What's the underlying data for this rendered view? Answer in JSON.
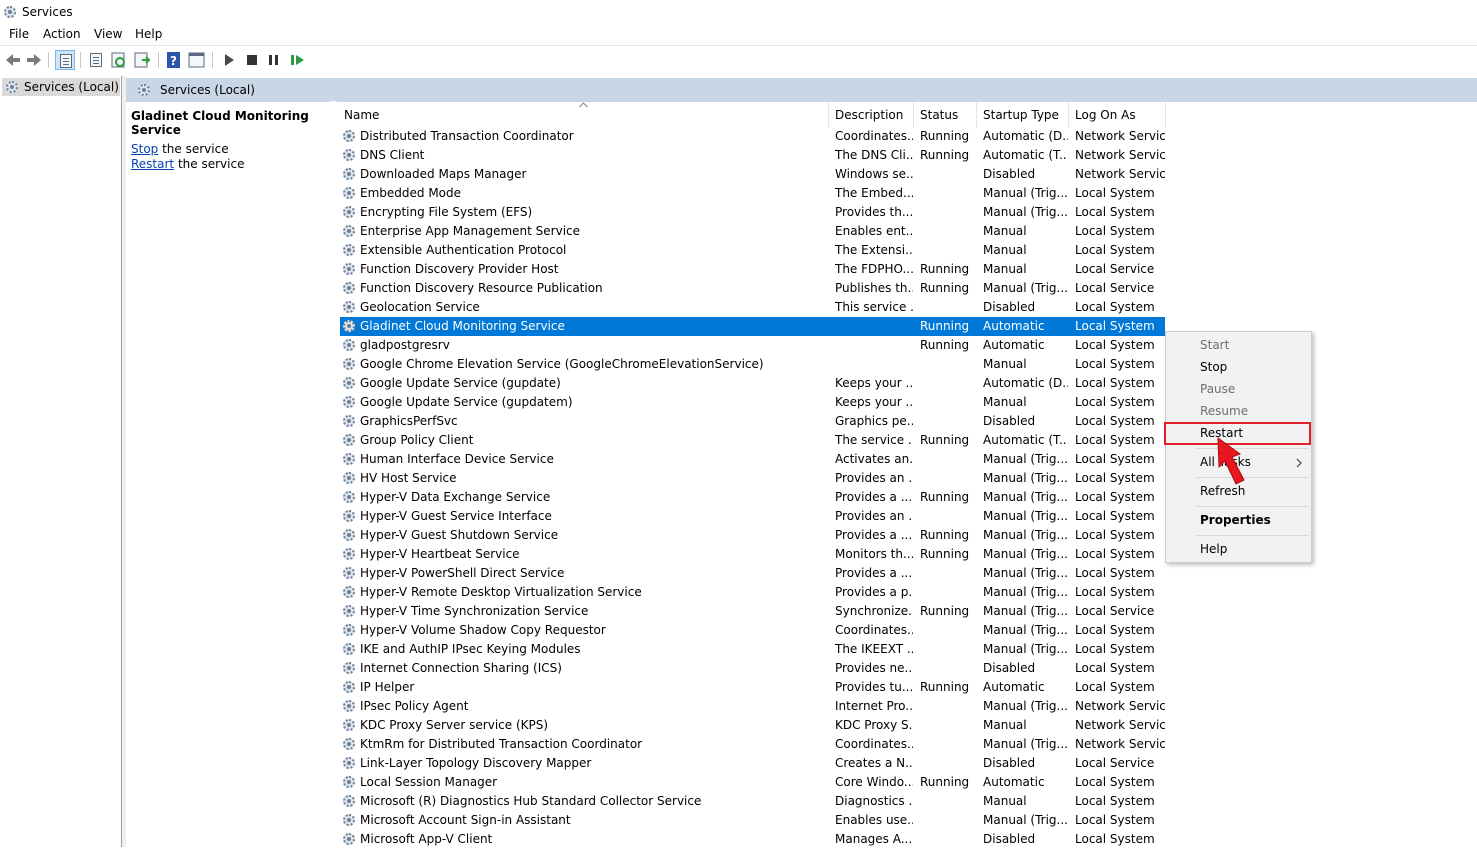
{
  "window": {
    "title": "Services"
  },
  "menu": [
    "File",
    "Action",
    "View",
    "Help"
  ],
  "tree": {
    "root": "Services (Local)"
  },
  "header": {
    "title": "Services (Local)"
  },
  "details": {
    "service_title": "Gladinet Cloud Monitoring Service",
    "stop_link": "Stop",
    "stop_rest": " the service",
    "restart_link": "Restart",
    "restart_rest": " the service"
  },
  "columns": [
    "Name",
    "Description",
    "Status",
    "Startup Type",
    "Log On As"
  ],
  "rows": [
    [
      "Distributed Transaction Coordinator",
      "Coordinates...",
      "Running",
      "Automatic (D...",
      "Network Service"
    ],
    [
      "DNS Client",
      "The DNS Cli...",
      "Running",
      "Automatic (T...",
      "Network Service"
    ],
    [
      "Downloaded Maps Manager",
      "Windows se...",
      "",
      "Disabled",
      "Network Service"
    ],
    [
      "Embedded Mode",
      "The Embed...",
      "",
      "Manual (Trig...",
      "Local System"
    ],
    [
      "Encrypting File System (EFS)",
      "Provides th...",
      "",
      "Manual (Trig...",
      "Local System"
    ],
    [
      "Enterprise App Management Service",
      "Enables ent...",
      "",
      "Manual",
      "Local System"
    ],
    [
      "Extensible Authentication Protocol",
      "The Extensi...",
      "",
      "Manual",
      "Local System"
    ],
    [
      "Function Discovery Provider Host",
      "The FDPHO...",
      "Running",
      "Manual",
      "Local Service"
    ],
    [
      "Function Discovery Resource Publication",
      "Publishes th...",
      "Running",
      "Manual (Trig...",
      "Local Service"
    ],
    [
      "Geolocation Service",
      "This service ...",
      "",
      "Disabled",
      "Local System"
    ],
    [
      "Gladinet Cloud Monitoring Service",
      "",
      "Running",
      "Automatic",
      "Local System"
    ],
    [
      "gladpostgresrv",
      "",
      "Running",
      "Automatic",
      "Local System"
    ],
    [
      "Google Chrome Elevation Service (GoogleChromeElevationService)",
      "",
      "",
      "Manual",
      "Local System"
    ],
    [
      "Google Update Service (gupdate)",
      "Keeps your ...",
      "",
      "Automatic (D...",
      "Local System"
    ],
    [
      "Google Update Service (gupdatem)",
      "Keeps your ...",
      "",
      "Manual",
      "Local System"
    ],
    [
      "GraphicsPerfSvc",
      "Graphics pe...",
      "",
      "Disabled",
      "Local System"
    ],
    [
      "Group Policy Client",
      "The service ...",
      "Running",
      "Automatic (T...",
      "Local System"
    ],
    [
      "Human Interface Device Service",
      "Activates an...",
      "",
      "Manual (Trig...",
      "Local System"
    ],
    [
      "HV Host Service",
      "Provides an ...",
      "",
      "Manual (Trig...",
      "Local System"
    ],
    [
      "Hyper-V Data Exchange Service",
      "Provides a ...",
      "Running",
      "Manual (Trig...",
      "Local System"
    ],
    [
      "Hyper-V Guest Service Interface",
      "Provides an ...",
      "",
      "Manual (Trig...",
      "Local System"
    ],
    [
      "Hyper-V Guest Shutdown Service",
      "Provides a ...",
      "Running",
      "Manual (Trig...",
      "Local System"
    ],
    [
      "Hyper-V Heartbeat Service",
      "Monitors th...",
      "Running",
      "Manual (Trig...",
      "Local System"
    ],
    [
      "Hyper-V PowerShell Direct Service",
      "Provides a ...",
      "",
      "Manual (Trig...",
      "Local System"
    ],
    [
      "Hyper-V Remote Desktop Virtualization Service",
      "Provides a p...",
      "",
      "Manual (Trig...",
      "Local System"
    ],
    [
      "Hyper-V Time Synchronization Service",
      "Synchronize...",
      "Running",
      "Manual (Trig...",
      "Local Service"
    ],
    [
      "Hyper-V Volume Shadow Copy Requestor",
      "Coordinates...",
      "",
      "Manual (Trig...",
      "Local System"
    ],
    [
      "IKE and AuthIP IPsec Keying Modules",
      "The IKEEXT ...",
      "",
      "Manual (Trig...",
      "Local System"
    ],
    [
      "Internet Connection Sharing (ICS)",
      "Provides ne...",
      "",
      "Disabled",
      "Local System"
    ],
    [
      "IP Helper",
      "Provides tu...",
      "Running",
      "Automatic",
      "Local System"
    ],
    [
      "IPsec Policy Agent",
      "Internet Pro...",
      "",
      "Manual (Trig...",
      "Network Service"
    ],
    [
      "KDC Proxy Server service (KPS)",
      "KDC Proxy S...",
      "",
      "Manual",
      "Network Service"
    ],
    [
      "KtmRm for Distributed Transaction Coordinator",
      "Coordinates...",
      "",
      "Manual (Trig...",
      "Network Service"
    ],
    [
      "Link-Layer Topology Discovery Mapper",
      "Creates a N...",
      "",
      "Disabled",
      "Local Service"
    ],
    [
      "Local Session Manager",
      "Core Windo...",
      "Running",
      "Automatic",
      "Local System"
    ],
    [
      "Microsoft (R) Diagnostics Hub Standard Collector Service",
      "Diagnostics ...",
      "",
      "Manual",
      "Local System"
    ],
    [
      "Microsoft Account Sign-in Assistant",
      "Enables use...",
      "",
      "Manual (Trig...",
      "Local System"
    ],
    [
      "Microsoft App-V Client",
      "Manages A...",
      "",
      "Disabled",
      "Local System"
    ]
  ],
  "selected_row": 10,
  "context_menu": {
    "start": "Start",
    "stop": "Stop",
    "pause": "Pause",
    "resume": "Resume",
    "restart": "Restart",
    "all_tasks": "All Tasks",
    "refresh": "Refresh",
    "properties": "Properties",
    "help": "Help"
  },
  "colors": {
    "selection": "#0078d7",
    "highlight_box": "#e0202a",
    "header_band": "#c9d6e6"
  }
}
